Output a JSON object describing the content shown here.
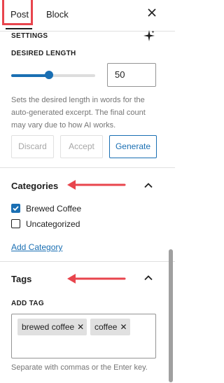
{
  "tabs": {
    "post": "Post",
    "block": "Block",
    "close_icon": "close-icon"
  },
  "settings": {
    "heading": "SETTINGS",
    "sparkle_icon": "sparkle-icon",
    "desired_length_label": "DESIRED LENGTH",
    "slider_fraction": 0.45,
    "length_value": "50",
    "help_text_lines": [
      "Sets the desired length in words for the",
      "auto-generated excerpt. The final count",
      "may vary due to how AI works."
    ],
    "buttons": {
      "discard": "Discard",
      "accept": "Accept",
      "generate": "Generate"
    }
  },
  "categories": {
    "title": "Categories",
    "chevron_icon": "chevron-up-icon",
    "items": [
      {
        "label": "Brewed Coffee",
        "checked": true
      },
      {
        "label": "Uncategorized",
        "checked": false
      }
    ],
    "add_link": "Add Category"
  },
  "tags": {
    "title": "Tags",
    "chevron_icon": "chevron-up-icon",
    "add_label": "ADD TAG",
    "tokens": [
      "brewed coffee",
      "coffee"
    ],
    "remove_glyph": "✕",
    "help": "Separate with commas or the Enter key."
  },
  "colors": {
    "accent": "#1a6fb3",
    "annotation": "#e8454d"
  }
}
